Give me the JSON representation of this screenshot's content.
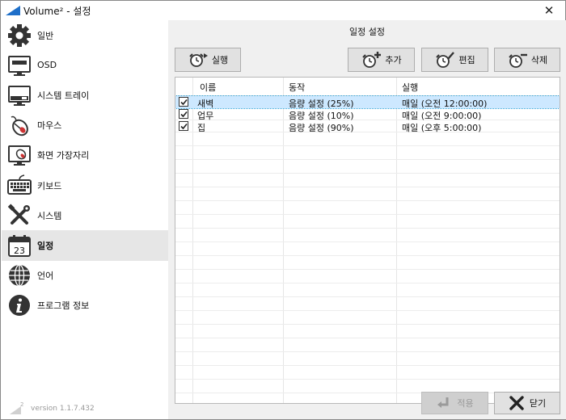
{
  "window": {
    "title": "Volume² - 설정",
    "close_icon": "close-icon"
  },
  "sidebar": {
    "items": [
      {
        "label": "일반",
        "icon": "gear-icon"
      },
      {
        "label": "OSD",
        "icon": "monitor-icon"
      },
      {
        "label": "시스템 트레이",
        "icon": "tray-icon"
      },
      {
        "label": "마우스",
        "icon": "mouse-icon"
      },
      {
        "label": "화면 가장자리",
        "icon": "screen-edge-icon"
      },
      {
        "label": "키보드",
        "icon": "keyboard-icon"
      },
      {
        "label": "시스템",
        "icon": "tools-icon"
      },
      {
        "label": "일정",
        "icon": "calendar-icon",
        "active": true,
        "calendar_day": "23"
      },
      {
        "label": "언어",
        "icon": "globe-icon"
      },
      {
        "label": "프로그램 정보",
        "icon": "info-icon"
      }
    ],
    "version_badge": "2",
    "version": "version 1.1.7.432"
  },
  "schedule": {
    "title": "일정 설정",
    "buttons": {
      "run": "실행",
      "add": "추가",
      "edit": "편집",
      "delete": "삭제"
    },
    "columns": {
      "name": "이름",
      "action": "동작",
      "run": "실행"
    },
    "rows": [
      {
        "checked": true,
        "name": "새벽",
        "action": "음량 설정 (25%)",
        "run": "매일 (오전 12:00:00)",
        "selected": true
      },
      {
        "checked": true,
        "name": "업무",
        "action": "음량 설정 (10%)",
        "run": "매일 (오전 9:00:00)",
        "selected": false
      },
      {
        "checked": true,
        "name": "집",
        "action": "음량 설정 (90%)",
        "run": "매일 (오후 5:00:00)",
        "selected": false
      }
    ]
  },
  "footer": {
    "apply": "적용",
    "close": "닫기"
  },
  "colors": {
    "selection": "#cde8ff",
    "sidebar_active": "#e6e6e6",
    "panel_bg": "#f0f0f0",
    "accent": "#1e6fc9"
  }
}
